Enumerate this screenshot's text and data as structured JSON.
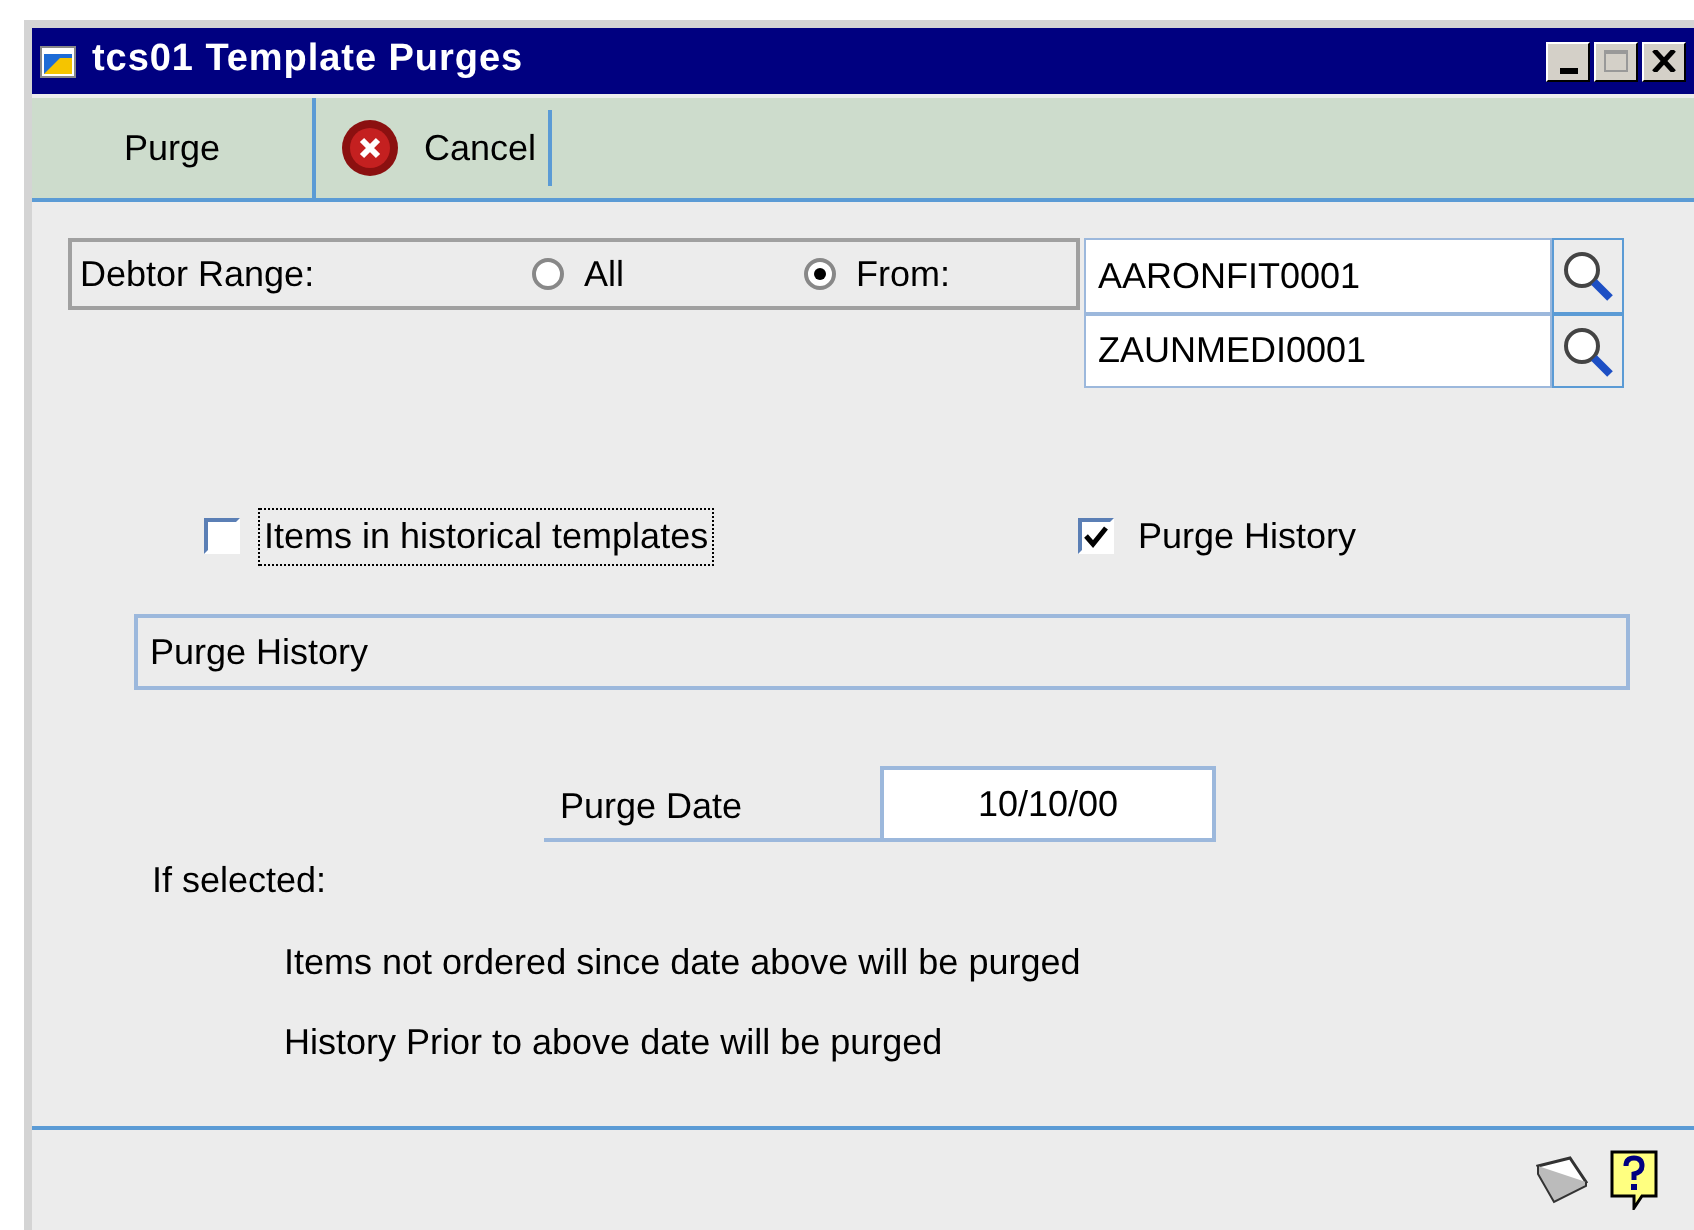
{
  "window": {
    "title": "tcs01 Template Purges"
  },
  "toolbar": [
    {
      "kind": "plain",
      "label": "Purge"
    },
    {
      "kind": "cancel",
      "label": "Cancel"
    }
  ],
  "debtor_range": {
    "label": "Debtor Range:",
    "options": [
      {
        "label": "All",
        "selected": false
      },
      {
        "label": "From:",
        "selected": true
      }
    ],
    "from": "AARONFIT0001",
    "to": "ZAUNMEDI0001"
  },
  "checkboxes": [
    {
      "label": "Items in historical templates",
      "checked": false,
      "focused": true
    },
    {
      "label": "Purge History",
      "checked": true,
      "focused": false
    }
  ],
  "section_title": "Purge History",
  "purge_date": {
    "label": "Purge Date",
    "value": "10/10/00"
  },
  "notes": {
    "heading": "If selected:",
    "lines": [
      "Items not ordered since date above will be purged",
      "History Prior to above date will be purged"
    ]
  }
}
